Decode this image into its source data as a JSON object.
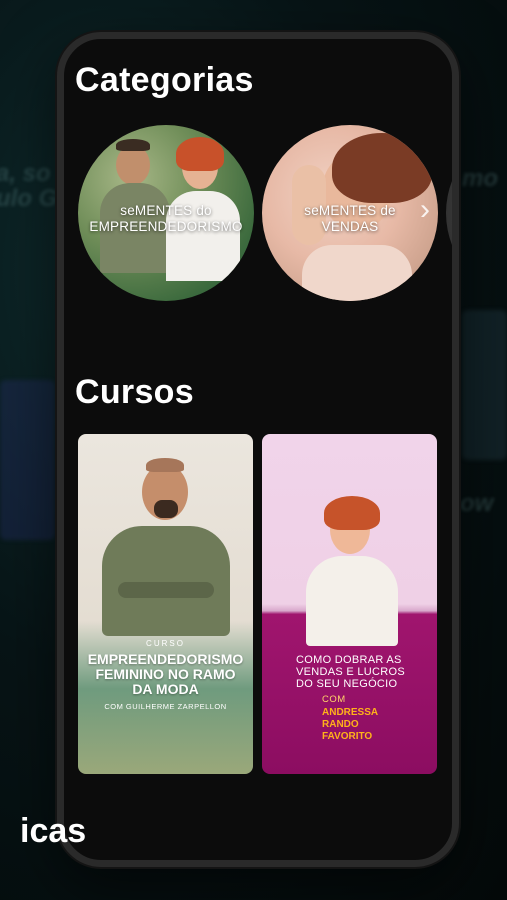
{
  "sections": {
    "categories_title": "Categorias",
    "courses_title": "Cursos",
    "next_title_fragment": "icas"
  },
  "categories": [
    {
      "label_line1": "seMENTES do",
      "label_line2": "EMPREENDEDORISMO"
    },
    {
      "label_line1": "seMENTES de",
      "label_line2": "VENDAS"
    }
  ],
  "courses": [
    {
      "kicker": "CURSO",
      "title_line1": "EMPREENDEDORISMO",
      "title_line2": "FEMININO NO RAMO",
      "title_line3": "DA MODA",
      "byline": "COM GUILHERME ZARPELLON"
    },
    {
      "title_line1": "COMO DOBRAR AS",
      "title_line2": "VENDAS E LUCROS",
      "title_line3": "DO SEU NEGÓCIO",
      "com": "COM",
      "name_line1": "ANDRESSA",
      "name_line2": "RANDO",
      "name_line3": "FAVORITO"
    }
  ],
  "icons": {
    "carousel_next": "chevron-right-icon"
  },
  "colors": {
    "app_background": "#0c0c0c",
    "accent_magenta": "#8c0d61",
    "accent_orange": "#ffb21a"
  }
}
